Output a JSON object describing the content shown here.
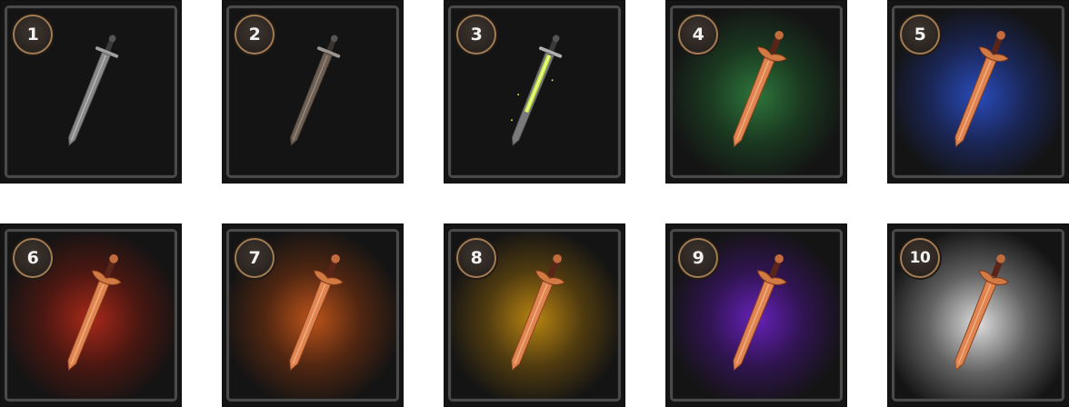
{
  "items": [
    {
      "number": "1",
      "sword": "steel-sword-icon",
      "glow": "none"
    },
    {
      "number": "2",
      "sword": "iron-sword-icon",
      "glow": "none"
    },
    {
      "number": "3",
      "sword": "enchanted-sword-icon",
      "glow": "none"
    },
    {
      "number": "4",
      "sword": "bronze-sword-icon",
      "glow": "#2f7a3c"
    },
    {
      "number": "5",
      "sword": "bronze-sword-icon",
      "glow": "#2a4fc4"
    },
    {
      "number": "6",
      "sword": "bronze-sword-icon",
      "glow": "#b0291a"
    },
    {
      "number": "7",
      "sword": "bronze-sword-icon",
      "glow": "#c4561a"
    },
    {
      "number": "8",
      "sword": "bronze-sword-icon",
      "glow": "#c18a12"
    },
    {
      "number": "9",
      "sword": "bronze-sword-icon",
      "glow": "#6a22c2"
    },
    {
      "number": "10",
      "sword": "bronze-sword-icon",
      "glow": "#e8e8e8"
    }
  ]
}
